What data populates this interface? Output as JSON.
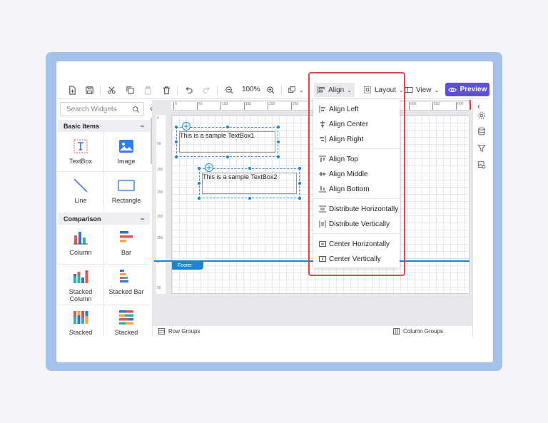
{
  "toolbar": {
    "zoom": "100%",
    "align_label": "Align",
    "layout_label": "Layout",
    "view_label": "View",
    "preview_label": "Preview"
  },
  "left_panel": {
    "search_placeholder": "Search Widgets",
    "basic_items": {
      "title": "Basic Items",
      "collapse": "−",
      "items": [
        "TextBox",
        "Image",
        "Line",
        "Rectangle"
      ]
    },
    "comparison": {
      "title": "Comparison",
      "collapse": "−",
      "items": [
        "Column",
        "Bar",
        "Stacked Column",
        "Stacked Bar",
        "Stacked",
        "Stacked"
      ]
    }
  },
  "ruler": {
    "h_ticks": [
      "0",
      "50",
      "100",
      "150",
      "200",
      "250",
      "300",
      "350",
      "400",
      "450",
      "500",
      "550",
      "600"
    ],
    "v_ticks": [
      "0",
      "50",
      "100",
      "150",
      "200",
      "250",
      "0",
      "50"
    ]
  },
  "canvas": {
    "textbox1": "This is a sample TextBox1",
    "textbox2": "This is a sample TextBox2",
    "footer_label": "Footer"
  },
  "bottom": {
    "row_groups": "Row Groups",
    "column_groups": "Column Groups"
  },
  "align_menu": {
    "items": [
      {
        "label": "Align Left",
        "icon": "align-left-icon"
      },
      {
        "label": "Align Center",
        "icon": "align-center-icon"
      },
      {
        "label": "Align Right",
        "icon": "align-right-icon"
      },
      {
        "label": "Align Top",
        "icon": "align-top-icon"
      },
      {
        "label": "Align Middle",
        "icon": "align-middle-icon"
      },
      {
        "label": "Align Bottom",
        "icon": "align-bottom-icon"
      },
      {
        "label": "Distribute Horizontally",
        "icon": "distribute-horizontally-icon"
      },
      {
        "label": "Distribute Vertically",
        "icon": "distribute-vertically-icon"
      },
      {
        "label": "Center Horizontally",
        "icon": "center-horizontally-icon"
      },
      {
        "label": "Center Vertically",
        "icon": "center-vertically-icon"
      }
    ]
  },
  "colors": {
    "accent": "#5b4fe0",
    "selection": "#1a86d0",
    "highlight": "#e0474a",
    "frame": "#a3c1ea"
  }
}
